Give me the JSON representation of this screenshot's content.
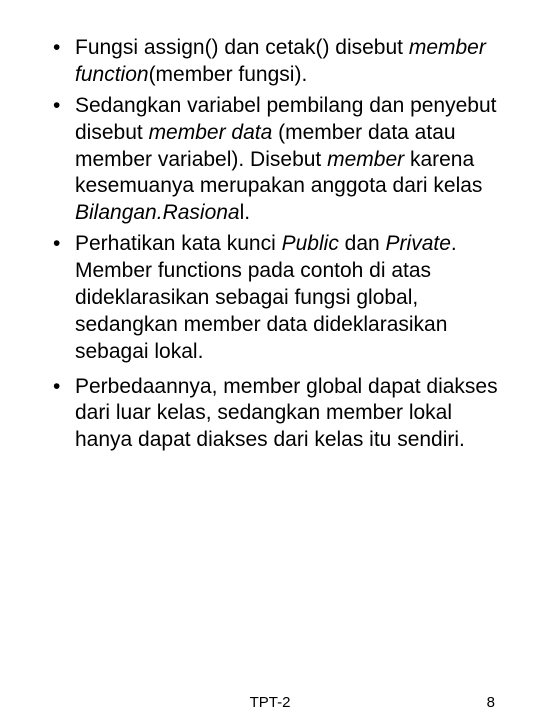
{
  "bullets": {
    "b1": {
      "t1": "Fungsi assign() dan cetak() disebut ",
      "i1": "member function",
      "t2": "(member fungsi)."
    },
    "b2": {
      "t1": "Sedangkan variabel pembilang dan penyebut disebut ",
      "i1": "member data",
      "t2": " (member data atau member variabel). Disebut ",
      "i2": "member",
      "t3": " karena kesemuanya merupakan anggota dari kelas ",
      "i3": "Bilangan.Rasiona",
      "t4": "l."
    },
    "b3": {
      "t1": "Perhatikan kata kunci ",
      "i1": "Public",
      "t2": " dan ",
      "i2": "Private",
      "t3": ". Member functions pada contoh di atas dideklarasikan sebagai fungsi global, sedangkan member data dideklarasikan sebagai lokal."
    },
    "b4": {
      "t1": "Perbedaannya, member global dapat diakses dari luar kelas, sedangkan member lokal hanya dapat diakses dari kelas itu sendiri."
    }
  },
  "footer": {
    "center": "TPT-2",
    "page": "8"
  }
}
